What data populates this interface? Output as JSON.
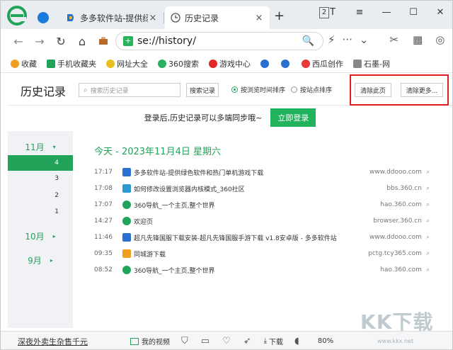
{
  "tabs": [
    {
      "label": "多多软件站-提供绿",
      "icon": "ddooo-favicon",
      "close": "×"
    },
    {
      "label": "历史记录",
      "icon": "clock-icon",
      "close": "×"
    }
  ],
  "tab_count": "2",
  "new_tab": "+",
  "window": {
    "min": "—",
    "max": "☐",
    "close": "✕",
    "skin": "T"
  },
  "toolbar": {
    "back": "←",
    "forward": "→",
    "refresh": "↻",
    "home": "⌂",
    "url": "se://history/",
    "search": "🔍",
    "flash": "⚡",
    "more": "···",
    "dropdown": "⌄",
    "ext": "✂"
  },
  "bookmarks": [
    {
      "label": "收藏",
      "icon": "star-icon",
      "color": "#f0a020"
    },
    {
      "label": "手机收藏夹",
      "icon": "phone-icon",
      "color": "#21a35a"
    },
    {
      "label": "网址大全",
      "icon": "navsite-icon",
      "color": "#e8c020"
    },
    {
      "label": "360搜索",
      "icon": "search-360-icon",
      "color": "#2ab060"
    },
    {
      "label": "游戏中心",
      "icon": "game-icon",
      "color": "#e02828"
    },
    {
      "label": "",
      "icon": "paw-icon",
      "color": "#2a6fd0"
    },
    {
      "label": "",
      "icon": "paw-icon",
      "color": "#2a6fd0"
    },
    {
      "label": "西瓜创作",
      "icon": "xigua-icon",
      "color": "#e83838"
    },
    {
      "label": "石墨-网",
      "icon": "doc-icon",
      "color": "#888888"
    }
  ],
  "header": {
    "title": "历史记录",
    "search_placeholder": "搜索历史记录",
    "search_button": "搜索记录",
    "radio_time": "按浏览时间排序",
    "radio_site": "按站点排序",
    "clear_page": "清除此页",
    "clear_more": "清除更多..."
  },
  "login": {
    "message": "登录后,历史记录可以多端同步哦~",
    "button": "立即登录"
  },
  "side": {
    "months": [
      {
        "label": "11月",
        "arrow": "▾"
      },
      {
        "label": "10月",
        "arrow": "▸"
      },
      {
        "label": "9月",
        "arrow": "▸"
      }
    ],
    "days": [
      "4",
      "3",
      "2",
      "1"
    ]
  },
  "date_header": "今天 - 2023年11月4日 星期六",
  "history": [
    {
      "time": "17:17",
      "title": "多多软件站-提供绿色软件和热门单机游戏下载",
      "domain": "www.ddooo.com",
      "icon_color": "#2a70d0"
    },
    {
      "time": "17:08",
      "title": "如何修改设置浏览器内核模式_360社区",
      "domain": "bbs.360.cn",
      "icon_color": "#2a9ad0"
    },
    {
      "time": "17:07",
      "title": "360导航_一个主页,整个世界",
      "domain": "hao.360.com",
      "icon_color": "#21a35a"
    },
    {
      "time": "14:27",
      "title": "欢迎页",
      "domain": "browser.360.cn",
      "icon_color": "#21a35a"
    },
    {
      "time": "11:46",
      "title": "超凡先锋国服下载安装-超凡先锋国服手游下载 v1.8安卓版 - 多多软件站",
      "domain": "www.ddooo.com",
      "icon_color": "#2a70d0"
    },
    {
      "time": "09:35",
      "title": "同城游下载",
      "domain": "pctg.tcy365.com",
      "icon_color": "#f0a020"
    },
    {
      "time": "08:52",
      "title": "360导航_一个主页,整个世界",
      "domain": "hao.360.com",
      "icon_color": "#21a35a"
    }
  ],
  "statusbar": {
    "left": "深夜外卖生杂售千元",
    "video": "我的视频",
    "download": "下载",
    "zoom": "80%"
  },
  "watermark": {
    "text": "KK下载",
    "url": "www.kkx.net"
  }
}
